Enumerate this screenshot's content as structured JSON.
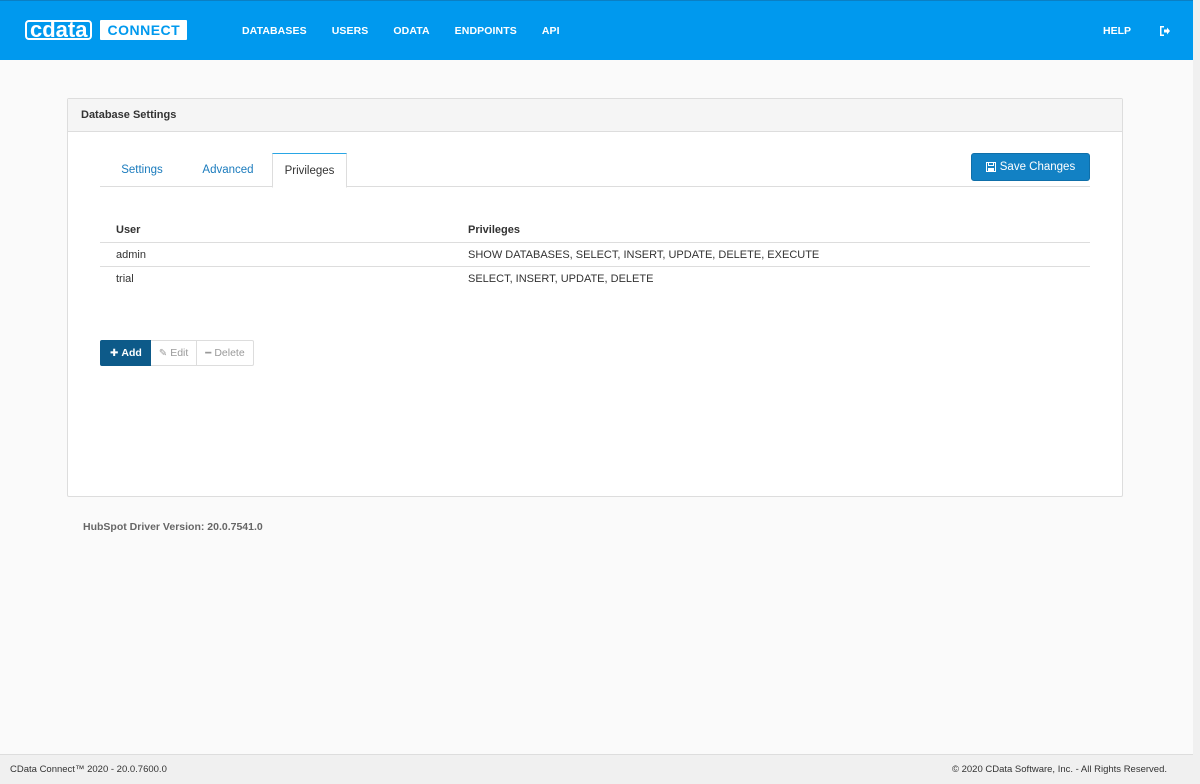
{
  "header": {
    "logo_word": "cdata",
    "logo_product": "CONNECT",
    "nav": [
      "DATABASES",
      "USERS",
      "ODATA",
      "ENDPOINTS",
      "API"
    ],
    "help_label": "HELP",
    "logout_icon": "sign-out-icon"
  },
  "panel": {
    "title": "Database Settings",
    "tabs": [
      "Settings",
      "Advanced",
      "Privileges"
    ],
    "active_tab": "Privileges",
    "save_label": "Save Changes"
  },
  "table": {
    "columns": [
      "User",
      "Privileges"
    ],
    "rows": [
      {
        "user": "admin",
        "privileges": "SHOW DATABASES, SELECT, INSERT, UPDATE, DELETE, EXECUTE"
      },
      {
        "user": "trial",
        "privileges": "SELECT, INSERT, UPDATE, DELETE"
      }
    ]
  },
  "actions": {
    "add_label": "Add",
    "edit_label": "Edit",
    "delete_label": "Delete"
  },
  "driver_version": "HubSpot Driver Version: 20.0.7541.0",
  "footer": {
    "left": "CData Connect™ 2020 - 20.0.7600.0",
    "right": "© 2020 CData Software, Inc. - All Rights Reserved."
  },
  "colors": {
    "topbar": "#0099ee",
    "save_button": "#1281c4",
    "add_button": "#0d5a89",
    "tab_link": "#1a7bbd"
  }
}
